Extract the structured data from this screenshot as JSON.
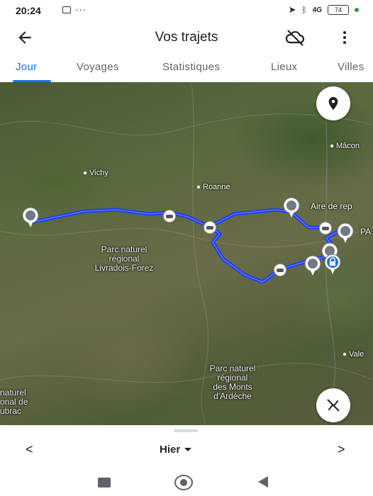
{
  "status_bar": {
    "time": "20:24",
    "left_icons": [
      "message-icon",
      "more-notifications-icon"
    ],
    "right_icons": [
      "location-arrow-icon",
      "bluetooth-icon",
      "signal-4g-icon",
      "battery-icon"
    ],
    "signal": "4G",
    "battery": "74"
  },
  "app_bar": {
    "title": "Vos trajets",
    "back_icon": "arrow-back-icon",
    "sync_icon": "cloud-off-icon",
    "menu_icon": "more-vert-icon"
  },
  "tabs": [
    {
      "label": "Jour",
      "active": true
    },
    {
      "label": "Voyages",
      "active": false
    },
    {
      "label": "Statistiques",
      "active": false
    },
    {
      "label": "Lieux",
      "active": false
    },
    {
      "label": "Villes",
      "active": false
    }
  ],
  "map": {
    "labels": {
      "macon": "Mâcon",
      "vichy": "Vichy",
      "roanne": "Roanne",
      "aire": "Aire de rep",
      "pa": "PA",
      "livradois_1": "Parc naturel",
      "livradois_2": "régional",
      "livradois_3": "Livradois-Forez",
      "ardeche_1": "Parc naturel",
      "ardeche_2": "régional",
      "ardeche_3": "des Monts",
      "ardeche_4": "d'Ardèche",
      "aubrac_1": "naturel",
      "aubrac_2": "onal de",
      "aubrac_3": "ubrac",
      "vale": "Vale"
    },
    "route_color": "#1a3cff",
    "locate_button_icon": "location-pin-icon",
    "layers_button_icon": "route-off-icon"
  },
  "bottom_sheet": {
    "date_label": "Hier",
    "prev_icon": "chevron-left-icon",
    "next_icon": "chevron-right-icon",
    "prev_glyph": "<",
    "next_glyph": ">"
  },
  "nav_bar": {
    "icons": [
      "recents-icon",
      "home-icon",
      "back-icon"
    ]
  }
}
